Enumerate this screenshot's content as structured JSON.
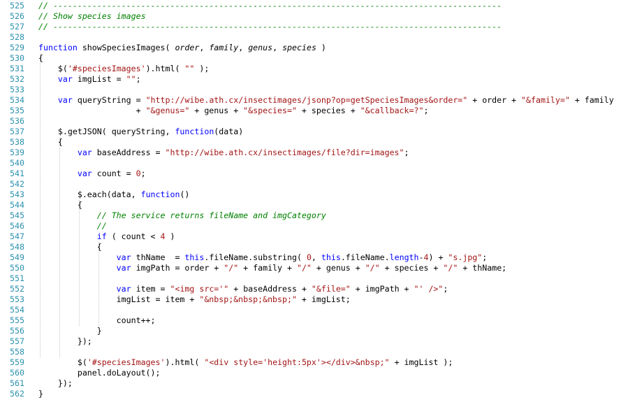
{
  "editor": {
    "colors": {
      "line_number": "#2b91af",
      "comment": "#008000",
      "keyword": "#0000ff",
      "string": "#a31515",
      "text": "#000000"
    },
    "lines": [
      {
        "n": "525",
        "tokens": [
          {
            "t": "cm",
            "v": "// --------------------------------------------------------------------------------------------"
          }
        ]
      },
      {
        "n": "526",
        "tokens": [
          {
            "t": "cm",
            "v": "// Show species images"
          }
        ]
      },
      {
        "n": "527",
        "tokens": [
          {
            "t": "cm",
            "v": "// --------------------------------------------------------------------------------------------"
          }
        ]
      },
      {
        "n": "528",
        "tokens": []
      },
      {
        "n": "529",
        "tokens": [
          {
            "t": "kw",
            "v": "function "
          },
          {
            "t": "pl",
            "v": "showSpeciesImages( "
          },
          {
            "t": "pf",
            "v": "order"
          },
          {
            "t": "pl",
            "v": ", "
          },
          {
            "t": "pf",
            "v": "family"
          },
          {
            "t": "pl",
            "v": ", "
          },
          {
            "t": "pf",
            "v": "genus"
          },
          {
            "t": "pl",
            "v": ", "
          },
          {
            "t": "pf",
            "v": "species"
          },
          {
            "t": "pl",
            "v": " )"
          }
        ]
      },
      {
        "n": "530",
        "tokens": [
          {
            "t": "pl",
            "v": "{"
          }
        ]
      },
      {
        "n": "531",
        "tokens": [
          {
            "t": "pl",
            "v": "    $("
          },
          {
            "t": "st",
            "v": "'#speciesImages'"
          },
          {
            "t": "pl",
            "v": ").html( "
          },
          {
            "t": "st",
            "v": "\"\""
          },
          {
            "t": "pl",
            "v": " );"
          }
        ]
      },
      {
        "n": "532",
        "tokens": [
          {
            "t": "kw",
            "v": "    var "
          },
          {
            "t": "pl",
            "v": "imgList = "
          },
          {
            "t": "st",
            "v": "\"\""
          },
          {
            "t": "pl",
            "v": ";"
          }
        ]
      },
      {
        "n": "533",
        "tokens": []
      },
      {
        "n": "534",
        "tokens": [
          {
            "t": "kw",
            "v": "    var "
          },
          {
            "t": "pl",
            "v": "queryString = "
          },
          {
            "t": "st",
            "v": "\"http://wibe.ath.cx/insectimages/jsonp?op=getSpeciesImages&order=\""
          },
          {
            "t": "pl",
            "v": " + order + "
          },
          {
            "t": "st",
            "v": "\"&family=\""
          },
          {
            "t": "pl",
            "v": " + family"
          }
        ]
      },
      {
        "n": "535",
        "tokens": [
          {
            "t": "pl",
            "v": "                    + "
          },
          {
            "t": "st",
            "v": "\"&genus=\""
          },
          {
            "t": "pl",
            "v": " + genus + "
          },
          {
            "t": "st",
            "v": "\"&species=\""
          },
          {
            "t": "pl",
            "v": " + species + "
          },
          {
            "t": "st",
            "v": "\"&callback=?\""
          },
          {
            "t": "pl",
            "v": ";"
          }
        ]
      },
      {
        "n": "536",
        "tokens": []
      },
      {
        "n": "537",
        "tokens": [
          {
            "t": "pl",
            "v": "    $.getJSON( queryString, "
          },
          {
            "t": "kw",
            "v": "function"
          },
          {
            "t": "pl",
            "v": "(data)"
          }
        ]
      },
      {
        "n": "538",
        "tokens": [
          {
            "t": "pl",
            "v": "    {"
          }
        ]
      },
      {
        "n": "539",
        "tokens": [
          {
            "t": "kw",
            "v": "        var "
          },
          {
            "t": "pl",
            "v": "baseAddress = "
          },
          {
            "t": "st",
            "v": "\"http://wibe.ath.cx/insectimages/file?dir=images\""
          },
          {
            "t": "pl",
            "v": ";"
          }
        ]
      },
      {
        "n": "540",
        "tokens": []
      },
      {
        "n": "541",
        "tokens": [
          {
            "t": "kw",
            "v": "        var "
          },
          {
            "t": "pl",
            "v": "count = "
          },
          {
            "t": "st",
            "v": "0"
          },
          {
            "t": "pl",
            "v": ";"
          }
        ]
      },
      {
        "n": "542",
        "tokens": []
      },
      {
        "n": "543",
        "tokens": [
          {
            "t": "pl",
            "v": "        $.each(data, "
          },
          {
            "t": "kw",
            "v": "function"
          },
          {
            "t": "pl",
            "v": "()"
          }
        ]
      },
      {
        "n": "544",
        "tokens": [
          {
            "t": "pl",
            "v": "        {"
          }
        ]
      },
      {
        "n": "545",
        "tokens": [
          {
            "t": "cm",
            "v": "            // The service returns fileName and imgCategory"
          }
        ]
      },
      {
        "n": "546",
        "tokens": [
          {
            "t": "cm",
            "v": "            //"
          }
        ]
      },
      {
        "n": "547",
        "tokens": [
          {
            "t": "kw",
            "v": "            if "
          },
          {
            "t": "pl",
            "v": "( count < "
          },
          {
            "t": "st",
            "v": "4"
          },
          {
            "t": "pl",
            "v": " )"
          }
        ]
      },
      {
        "n": "548",
        "tokens": [
          {
            "t": "pl",
            "v": "            {"
          }
        ]
      },
      {
        "n": "549",
        "tokens": [
          {
            "t": "kw",
            "v": "                var "
          },
          {
            "t": "pl",
            "v": "thName  = "
          },
          {
            "t": "kw",
            "v": "this"
          },
          {
            "t": "pl",
            "v": ".fileName.substring( "
          },
          {
            "t": "st",
            "v": "0"
          },
          {
            "t": "pl",
            "v": ", "
          },
          {
            "t": "kw",
            "v": "this"
          },
          {
            "t": "pl",
            "v": ".fileName."
          },
          {
            "t": "kw",
            "v": "length"
          },
          {
            "t": "pl",
            "v": "-"
          },
          {
            "t": "st",
            "v": "4"
          },
          {
            "t": "pl",
            "v": ") + "
          },
          {
            "t": "st",
            "v": "\"s.jpg\""
          },
          {
            "t": "pl",
            "v": ";"
          }
        ]
      },
      {
        "n": "550",
        "tokens": [
          {
            "t": "kw",
            "v": "                var "
          },
          {
            "t": "pl",
            "v": "imgPath = order + "
          },
          {
            "t": "st",
            "v": "\"/\""
          },
          {
            "t": "pl",
            "v": " + family + "
          },
          {
            "t": "st",
            "v": "\"/\""
          },
          {
            "t": "pl",
            "v": " + genus + "
          },
          {
            "t": "st",
            "v": "\"/\""
          },
          {
            "t": "pl",
            "v": " + species + "
          },
          {
            "t": "st",
            "v": "\"/\""
          },
          {
            "t": "pl",
            "v": " + thName;"
          }
        ]
      },
      {
        "n": "551",
        "tokens": []
      },
      {
        "n": "552",
        "tokens": [
          {
            "t": "kw",
            "v": "                var "
          },
          {
            "t": "pl",
            "v": "item = "
          },
          {
            "t": "st",
            "v": "\"<img src='\""
          },
          {
            "t": "pl",
            "v": " + baseAddress + "
          },
          {
            "t": "st",
            "v": "\"&file=\""
          },
          {
            "t": "pl",
            "v": " + imgPath + "
          },
          {
            "t": "st",
            "v": "\"' />\""
          },
          {
            "t": "pl",
            "v": ";"
          }
        ]
      },
      {
        "n": "553",
        "tokens": [
          {
            "t": "pl",
            "v": "                imgList = item + "
          },
          {
            "t": "st",
            "v": "\"&nbsp;&nbsp;&nbsp;\""
          },
          {
            "t": "pl",
            "v": " + imgList;"
          }
        ]
      },
      {
        "n": "554",
        "tokens": []
      },
      {
        "n": "555",
        "tokens": [
          {
            "t": "pl",
            "v": "                count++;"
          }
        ]
      },
      {
        "n": "556",
        "tokens": [
          {
            "t": "pl",
            "v": "            }"
          }
        ]
      },
      {
        "n": "557",
        "tokens": [
          {
            "t": "pl",
            "v": "        });"
          }
        ]
      },
      {
        "n": "558",
        "tokens": []
      },
      {
        "n": "559",
        "tokens": [
          {
            "t": "pl",
            "v": "        $("
          },
          {
            "t": "st",
            "v": "'#speciesImages'"
          },
          {
            "t": "pl",
            "v": ").html( "
          },
          {
            "t": "st",
            "v": "\"<div style='height:5px'></div>&nbsp;\""
          },
          {
            "t": "pl",
            "v": " + imgList );"
          }
        ]
      },
      {
        "n": "560",
        "tokens": [
          {
            "t": "pl",
            "v": "        panel.doLayout();"
          }
        ]
      },
      {
        "n": "561",
        "tokens": [
          {
            "t": "pl",
            "v": "    });"
          }
        ]
      },
      {
        "n": "562",
        "tokens": [
          {
            "t": "pl",
            "v": "}"
          }
        ]
      }
    ]
  }
}
